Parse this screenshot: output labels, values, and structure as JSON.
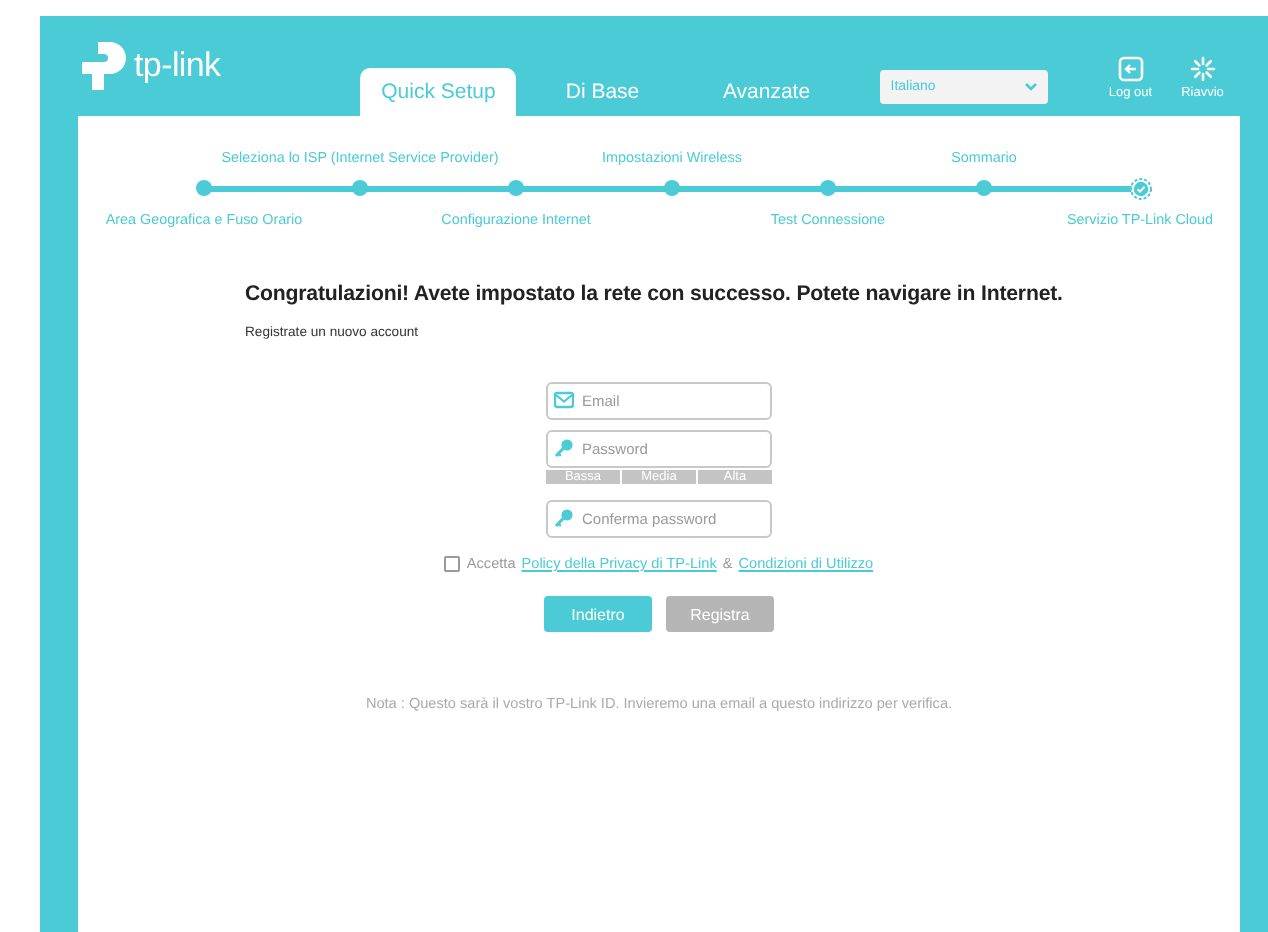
{
  "header": {
    "logo": "tp-link",
    "tabs": [
      {
        "label": "Quick Setup",
        "selected": true
      },
      {
        "label": "Di Base",
        "selected": false
      },
      {
        "label": "Avanzate",
        "selected": false
      }
    ],
    "language": {
      "value": "Italiano"
    },
    "actions": [
      {
        "kind": "logout",
        "label": "Log out"
      },
      {
        "kind": "reboot",
        "label": "Riavvio"
      }
    ]
  },
  "steps": [
    {
      "label": "Area Geografica e Fuso Orario",
      "current": false
    },
    {
      "label": "Seleziona lo ISP (Internet Service Provider)",
      "current": false
    },
    {
      "label": "Configurazione Internet",
      "current": false
    },
    {
      "label": "Impostazioni Wireless",
      "current": false
    },
    {
      "label": "Test Connessione",
      "current": false
    },
    {
      "label": "Sommario",
      "current": false
    },
    {
      "label": "Servizio TP-Link Cloud",
      "current": true
    }
  ],
  "headline": "Congratulazioni! Avete impostato la rete con successo. Potete navigare in Internet.",
  "subtitle": "Registrate un nuovo account",
  "fields": [
    {
      "kind": "email",
      "placeholder": "Email"
    },
    {
      "kind": "password",
      "placeholder": "Password"
    },
    {
      "kind": "password",
      "placeholder": "Conferma password"
    }
  ],
  "strength_labels": [
    "Bassa",
    "Media",
    "Alta"
  ],
  "agreement": {
    "checked": false,
    "text": "Accetta",
    "link_1": "Policy della Privacy di TP-Link",
    "joiner": "&",
    "link_2": "Condizioni di Utilizzo"
  },
  "buttons": [
    {
      "label": "Indietro",
      "disabled": false
    },
    {
      "label": "Registra",
      "disabled": true
    }
  ],
  "note": "Nota : Questo sarà il vostro TP-Link ID. Invieremo una email a questo indirizzo per verifica."
}
